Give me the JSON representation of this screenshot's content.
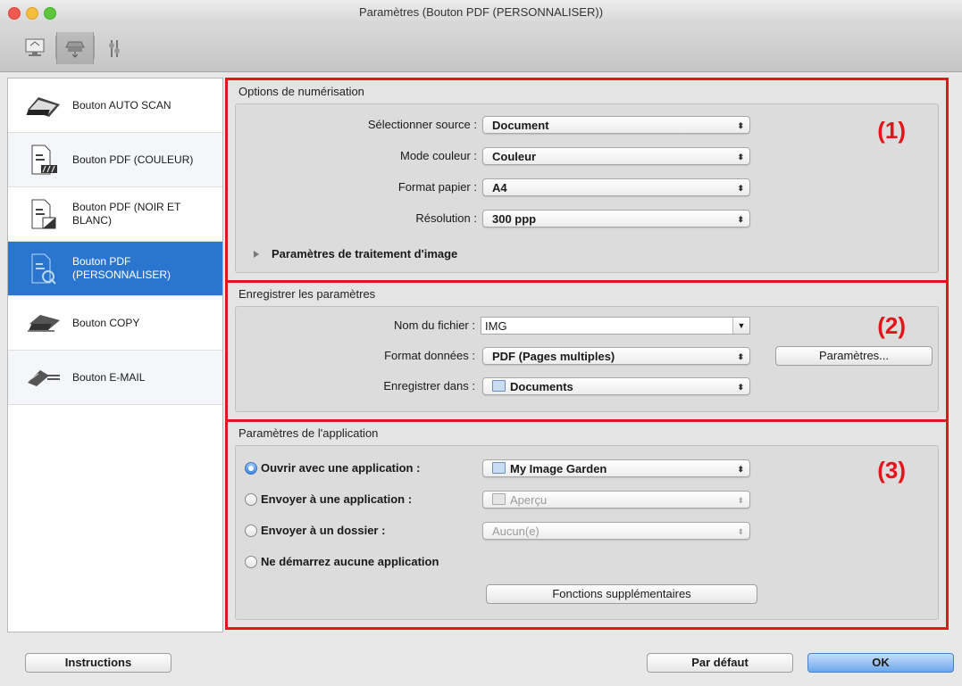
{
  "window": {
    "title": "Paramètres (Bouton PDF (PERSONNALISER))"
  },
  "sidebar": {
    "items": [
      {
        "label": "Bouton AUTO SCAN",
        "icon": "scanner-icon"
      },
      {
        "label": "Bouton PDF (COULEUR)",
        "icon": "pdf-color-icon"
      },
      {
        "label": "Bouton PDF (NOIR ET BLANC)",
        "icon": "pdf-bw-icon"
      },
      {
        "label": "Bouton PDF (PERSONNALISER)",
        "icon": "pdf-custom-icon",
        "selected": true
      },
      {
        "label": "Bouton COPY",
        "icon": "copy-icon"
      },
      {
        "label": "Bouton E-MAIL",
        "icon": "email-icon"
      }
    ]
  },
  "scan_options": {
    "title": "Options de numérisation",
    "number": "(1)",
    "source_label": "Sélectionner source :",
    "source_value": "Document",
    "color_label": "Mode couleur :",
    "color_value": "Couleur",
    "paper_label": "Format papier :",
    "paper_value": "A4",
    "resolution_label": "Résolution :",
    "resolution_value": "300 ppp",
    "image_processing_label": "Paramètres de traitement d'image"
  },
  "save_settings": {
    "title": "Enregistrer les paramètres",
    "number": "(2)",
    "filename_label": "Nom du fichier :",
    "filename_value": "IMG",
    "format_label": "Format données :",
    "format_value": "PDF (Pages multiples)",
    "format_button": "Paramètres...",
    "save_in_label": "Enregistrer dans :",
    "save_in_value": "Documents"
  },
  "app_settings": {
    "title": "Paramètres de l'application",
    "number": "(3)",
    "open_app_label": "Ouvrir avec une application :",
    "open_app_value": "My Image Garden",
    "send_app_label": "Envoyer à une application :",
    "send_app_value": "Aperçu",
    "send_folder_label": "Envoyer à un dossier :",
    "send_folder_value": "Aucun(e)",
    "no_app_label": "Ne démarrez aucune application",
    "extra_button": "Fonctions supplémentaires"
  },
  "footer": {
    "instructions_button": "Instructions",
    "default_button": "Par défaut",
    "ok_button": "OK"
  }
}
